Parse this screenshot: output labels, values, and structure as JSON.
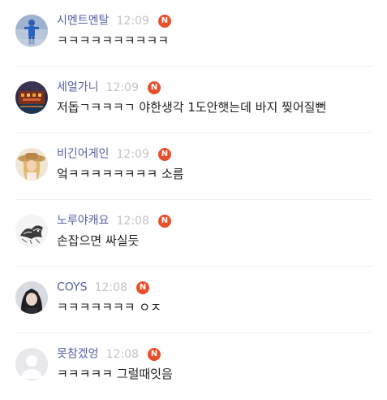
{
  "colors": {
    "nickname": "#5560a6",
    "time": "#c4c4c4",
    "badge": "#e8502b",
    "body_text": "#222222",
    "divider": "#efefef"
  },
  "comments": [
    {
      "nickname": "시멘트멘탈",
      "time": "12:09",
      "badge": "N",
      "text": "ㅋㅋㅋㅋㅋㅋㅋㅋㅋㅋ",
      "avatar": "blue-figure-avatar"
    },
    {
      "nickname": "세얼가니",
      "time": "12:09",
      "badge": "N",
      "text": "저돕ㄱㅋㅋㅋㄱ  야한생각 1도안햇는데 바지 찢어질뻔",
      "avatar": "night-building-avatar"
    },
    {
      "nickname": "비긴어게인",
      "time": "12:09",
      "badge": "N",
      "text": "엌ㅋㅋㅋㅋㅋㅋㅋㅋ 소름",
      "avatar": "hat-girl-avatar"
    },
    {
      "nickname": "노루야캐요",
      "time": "12:08",
      "badge": "N",
      "text": "손잡으면 싸실듯",
      "avatar": "sketch-animal-avatar"
    },
    {
      "nickname": "COYS",
      "time": "12:08",
      "badge": "N",
      "text": "ㅋㅋㅋㅋㅋㅋㅋ ㅇㅈ",
      "avatar": "dark-hair-avatar"
    },
    {
      "nickname": "못참겠엉",
      "time": "12:08",
      "badge": "N",
      "text": "ㅋㅋㅋㅋㅋ 그럴때잇음",
      "avatar": "default-user-avatar"
    }
  ]
}
